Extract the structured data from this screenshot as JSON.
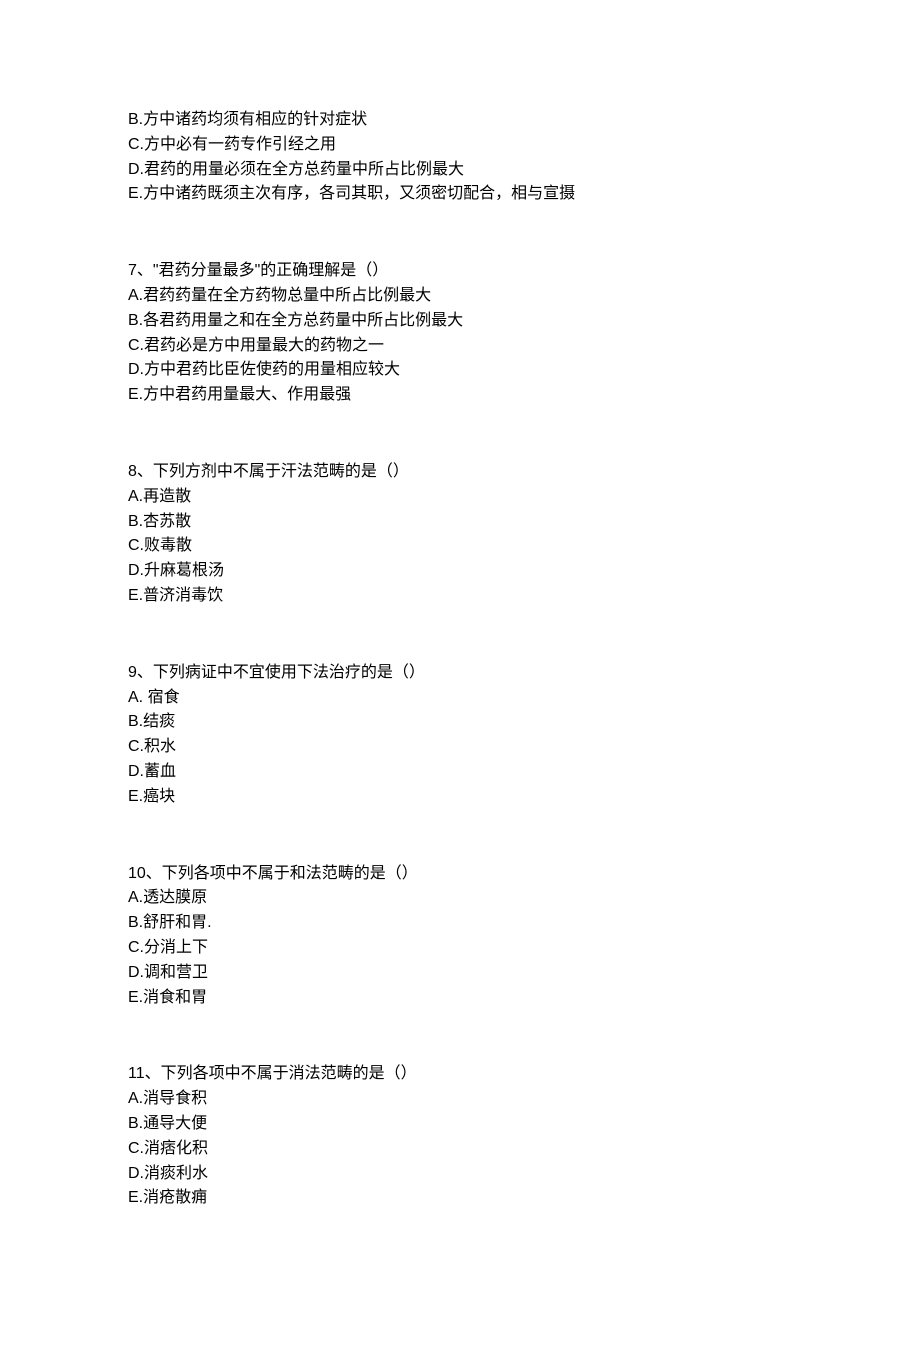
{
  "continuation": {
    "options": [
      "B.方中诸药均须有相应的针对症状",
      "C.方中必有一药专作引经之用",
      "D.君药的用量必须在全方总药量中所占比例最大",
      "E.方中诸药既须主次有序，各司其职，又须密切配合，相与宣摄"
    ]
  },
  "questions": [
    {
      "stem": "7、\"君药分量最多\"的正确理解是（）",
      "options": [
        "A.君药药量在全方药物总量中所占比例最大",
        "B.各君药用量之和在全方总药量中所占比例最大",
        "C.君药必是方中用量最大的药物之一",
        "D.方中君药比臣佐使药的用量相应较大",
        "E.方中君药用量最大、作用最强"
      ]
    },
    {
      "stem": "8、下列方剂中不属于汗法范畴的是（）",
      "options": [
        "A.再造散",
        "B.杏苏散",
        "C.败毒散",
        "D.升麻葛根汤",
        "E.普济消毒饮"
      ]
    },
    {
      "stem": "9、下列病证中不宜使用下法治疗的是（）",
      "options": [
        "A. 宿食",
        "B.结痰",
        "C.积水",
        "D.蓄血",
        "E.癌块"
      ]
    },
    {
      "stem": "10、下列各项中不属于和法范畴的是（）",
      "options": [
        "A.透达膜原",
        "B.舒肝和胃.",
        "C.分消上下",
        "D.调和营卫",
        "E.消食和胃"
      ]
    },
    {
      "stem": "11、下列各项中不属于消法范畴的是（）",
      "options": [
        "A.消导食积",
        "B.通导大便",
        "C.消痞化积",
        "D.消痰利水",
        "E.消疮散痈"
      ]
    }
  ]
}
